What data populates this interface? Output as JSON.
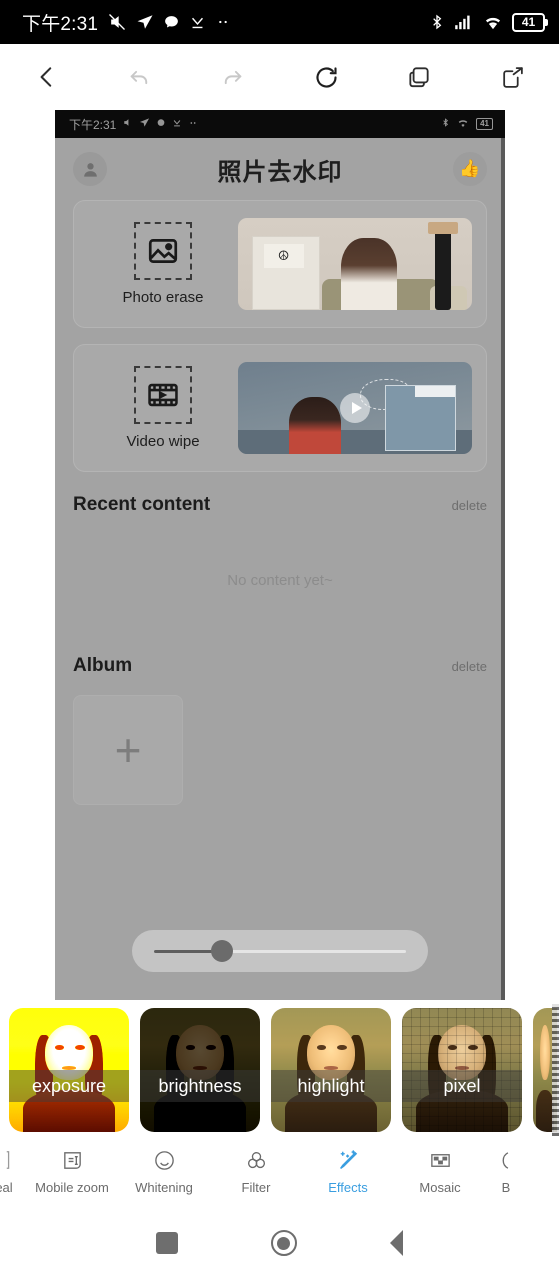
{
  "status_bar": {
    "time": "下午2:31",
    "left_icons": [
      "mute-icon",
      "navigation-icon",
      "message-icon",
      "download-icon",
      "more-icon"
    ],
    "right_icons": [
      "bluetooth-icon",
      "signal-icon",
      "wifi-icon"
    ],
    "battery_level": "41"
  },
  "browser_toolbar": {
    "buttons": [
      {
        "name": "back-button",
        "icon": "chevron-left-icon",
        "enabled": true
      },
      {
        "name": "undo-button",
        "icon": "undo-arrow-icon",
        "enabled": false
      },
      {
        "name": "redo-button",
        "icon": "redo-arrow-icon",
        "enabled": false
      },
      {
        "name": "refresh-button",
        "icon": "refresh-icon",
        "enabled": true
      },
      {
        "name": "tabs-button",
        "icon": "tabs-icon",
        "enabled": true
      },
      {
        "name": "share-button",
        "icon": "share-icon",
        "enabled": true
      }
    ]
  },
  "app": {
    "status_bar": {
      "time": "下午2:31",
      "battery_level": "41"
    },
    "header": {
      "title": "照片去水印",
      "avatar_icon": "user-avatar-icon",
      "vip_icon": "crown-icon"
    },
    "feature_cards": [
      {
        "label": "Photo erase",
        "icon": "image-placeholder-icon"
      },
      {
        "label": "Video wipe",
        "icon": "film-strip-icon"
      }
    ],
    "recent": {
      "title": "Recent content",
      "delete_label": "delete",
      "empty_text": "No content yet~"
    },
    "album": {
      "title": "Album",
      "delete_label": "delete",
      "add_icon": "plus-icon"
    },
    "slider": {
      "name": "adjustment-slider",
      "value_percent": 27
    }
  },
  "filter_strip": {
    "tiles": [
      {
        "label": "exposure"
      },
      {
        "label": "brightness"
      },
      {
        "label": "highlight"
      },
      {
        "label": "pixel"
      },
      {
        "label": ""
      }
    ]
  },
  "tool_tabs": {
    "items": [
      {
        "label": "eal",
        "icon": "heal-icon",
        "active": false
      },
      {
        "label": "Mobile zoom",
        "icon": "mobile-zoom-icon",
        "active": false
      },
      {
        "label": "Whitening",
        "icon": "smiley-face-icon",
        "active": false
      },
      {
        "label": "Filter",
        "icon": "three-circles-icon",
        "active": false
      },
      {
        "label": "Effects",
        "icon": "magic-wand-icon",
        "active": true
      },
      {
        "label": "Mosaic",
        "icon": "mosaic-icon",
        "active": false
      },
      {
        "label": "B",
        "icon": "blur-icon",
        "active": false
      }
    ],
    "active_color": "#3a9ee0"
  },
  "android_nav": {
    "recents_label": "recents-button",
    "home_label": "home-button",
    "back_label": "back-button"
  }
}
